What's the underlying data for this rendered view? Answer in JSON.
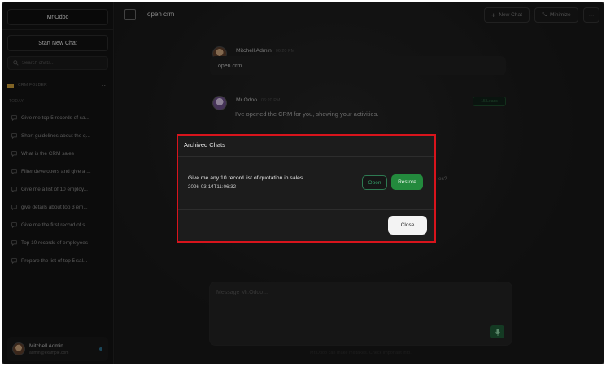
{
  "sidebar": {
    "brand": "Mr.Odoo",
    "new_chat_label": "Start New Chat",
    "search_placeholder": "Search chats...",
    "folder_label": "CRM FOLDER",
    "section_today": "TODAY",
    "chats": [
      {
        "label": "Give me top 5 records of sa..."
      },
      {
        "label": "Short guidelines about the q..."
      },
      {
        "label": "What is the CRM sales"
      },
      {
        "label": "Filter developers and give a ..."
      },
      {
        "label": "Give me a list of 10 employ..."
      },
      {
        "label": "give details about top 3 em..."
      },
      {
        "label": "Give me the first record of s..."
      },
      {
        "label": "Top 10 records of employees"
      },
      {
        "label": "Prepare the list of top 5 sal..."
      }
    ],
    "user": {
      "name": "Mitchell Admin",
      "email": "admin@example.com"
    }
  },
  "header": {
    "title": "open crm",
    "new_chat_label": "New Chat",
    "minimize_label": "Minimize",
    "more_label": "⋯"
  },
  "conversation": {
    "user_name": "Mitchell Admin",
    "user_time": "06:20 PM",
    "user_message": "open crm",
    "bot_name": "Mr.Odoo",
    "bot_time": "06:20 PM",
    "bot_message": "I've opened the CRM for you, showing your activities.",
    "bot_badge": "15 Leads",
    "partial_text": "es?"
  },
  "composer": {
    "placeholder": "Message Mr.Odoo...",
    "footer": "Mr.Odoo can make mistakes. Check important info."
  },
  "modal": {
    "title": "Archived Chats",
    "item_title": "Give me any 10 record list of quotation in sales",
    "item_date": "2026-03-14T11:06:32",
    "open_label": "Open",
    "restore_label": "Restore",
    "close_label": "Close"
  },
  "colors": {
    "accent_green": "#238a3d",
    "highlight_border": "#d8141c",
    "background": "#161616"
  }
}
